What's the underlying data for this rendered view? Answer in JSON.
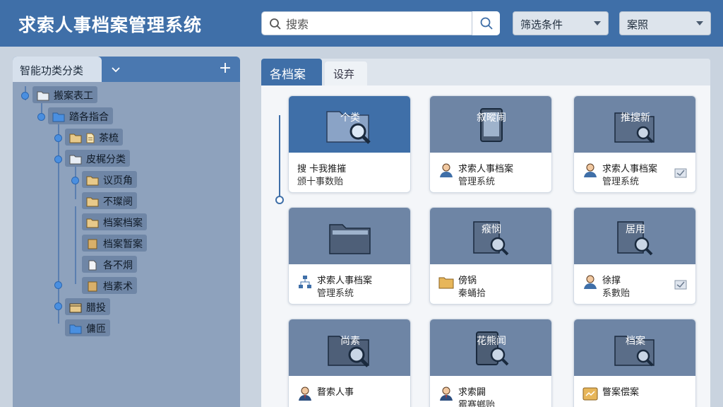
{
  "header": {
    "title": "求索人事档案管理系统",
    "search_placeholder": "搜索",
    "filter_label": "筛选条件",
    "sort_label": "案照"
  },
  "sidebar": {
    "tab_label": "智能功类分类",
    "items": [
      {
        "label": "搬案表工",
        "icon": "folder-icon"
      },
      {
        "label": "踏各指合",
        "icon": "folder-icon"
      },
      {
        "label": "茶梳",
        "icon": "document-icon"
      },
      {
        "label": "皮梶分类",
        "icon": "folder-icon"
      },
      {
        "label": "议页角",
        "icon": "folder-icon"
      },
      {
        "label": "不璨阌",
        "icon": "folder-icon"
      },
      {
        "label": "档案档案",
        "icon": "folder-icon"
      },
      {
        "label": "档案暂案",
        "icon": "file-icon"
      },
      {
        "label": "各不烔",
        "icon": "document-icon"
      },
      {
        "label": "档素术",
        "icon": "file-icon"
      },
      {
        "label": "腊投",
        "icon": "archive-icon"
      },
      {
        "label": "傭匝",
        "icon": "folder-icon"
      }
    ]
  },
  "main": {
    "tabs": [
      {
        "label": "各档案"
      },
      {
        "label": "设弃"
      }
    ],
    "cards": [
      {
        "thumb_label": "个类",
        "line1": "搜 卡我推摧",
        "line2": "颁十事数贻",
        "icon": "",
        "check": false,
        "selected": true
      },
      {
        "thumb_label": "叙暰闹",
        "line1": "求索人事档案",
        "line2": "管理系统",
        "icon": "person-icon",
        "check": false,
        "selected": false
      },
      {
        "thumb_label": "推搜新",
        "line1": "求索人事档案",
        "line2": "管理系统",
        "icon": "person-icon",
        "check": true,
        "selected": false
      },
      {
        "thumb_label": "",
        "line1": "求索人事档案",
        "line2": "管理系统",
        "icon": "network-icon",
        "check": false,
        "selected": false
      },
      {
        "thumb_label": "瘊悯",
        "line1": "傍锅",
        "line2": "秦蛹拾",
        "icon": "folder-icon",
        "check": false,
        "selected": false
      },
      {
        "thumb_label": "居用",
        "line1": "徐撑",
        "line2": "系數贻",
        "icon": "person-icon",
        "check": true,
        "selected": false
      },
      {
        "thumb_label": "尚素",
        "line1": "瞀索人事",
        "line2": "",
        "icon": "person-icon",
        "check": false,
        "selected": false
      },
      {
        "thumb_label": "花熊闻",
        "line1": "求索闢",
        "line2": "霉赛螂贻",
        "icon": "person-icon",
        "check": false,
        "selected": false
      },
      {
        "thumb_label": "档案",
        "line1": "瞥案偿案",
        "line2": "",
        "icon": "folder-icon",
        "check": false,
        "selected": false
      }
    ]
  }
}
